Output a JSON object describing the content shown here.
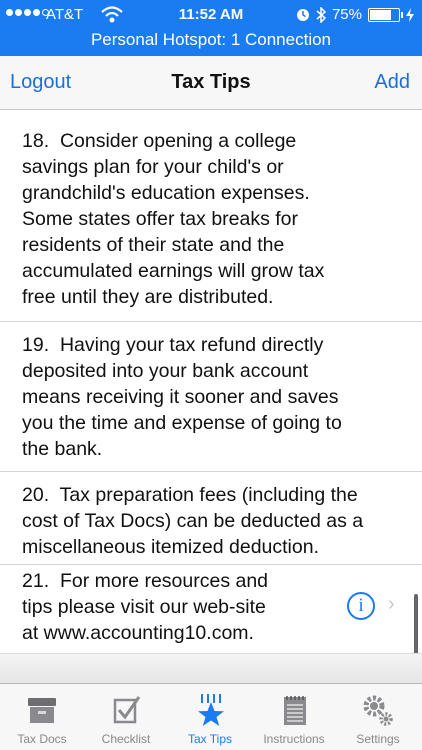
{
  "status_bar": {
    "carrier": "AT&T",
    "time": "11:52 AM",
    "battery": "75%",
    "battery_level": 0.75,
    "hotspot": "Personal Hotspot: 1 Connection"
  },
  "nav": {
    "left_button": "Logout",
    "title": "Tax Tips",
    "right_button": "Add"
  },
  "tips": [
    {
      "text": "18.  Consider opening a college\nsavings plan for your child's or\ngrandchild's education expenses.\nSome states offer tax breaks for\nresidents of their state and the\naccumulated earnings will grow tax\nfree until they are distributed."
    },
    {
      "text": "19.  Having your tax refund directly\ndeposited into your bank account\nmeans receiving it sooner and saves\nyou the time and expense of going to\nthe bank."
    },
    {
      "text": "20.  Tax preparation fees (including the\ncost of Tax Docs) can be deducted as a\nmiscellaneous itemized deduction."
    },
    {
      "text": "21.  For more resources and\ntips please visit our web-site\nat www.accounting10.com."
    }
  ],
  "tab_bar": {
    "items": [
      {
        "label": "Tax Docs",
        "icon": "file-box-icon",
        "active": false
      },
      {
        "label": "Checklist",
        "icon": "checklist-icon",
        "active": false
      },
      {
        "label": "Tax Tips",
        "icon": "star-icon",
        "active": true
      },
      {
        "label": "Instructions",
        "icon": "notepad-icon",
        "active": false
      },
      {
        "label": "Settings",
        "icon": "gears-icon",
        "active": false
      }
    ]
  },
  "colors": {
    "status_blue": "#1a7cf0",
    "link_blue": "#1a6fd8",
    "inactive_gray": "#888888"
  }
}
